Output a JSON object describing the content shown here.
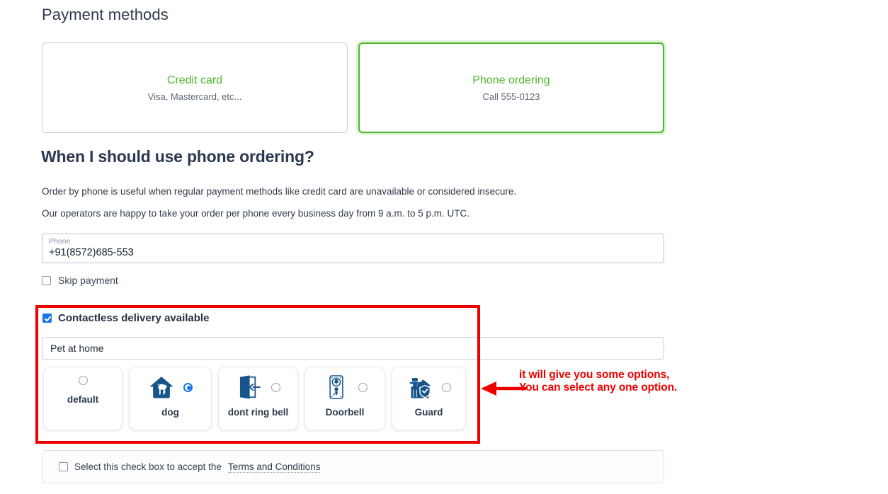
{
  "page_title": "Payment methods",
  "accent_green": "#4cb82a",
  "accent_blue": "#1a73e8",
  "annotation_red": "#ee0000",
  "payment_methods": [
    {
      "title": "Credit card",
      "subtitle": "Visa, Mastercard, etc...",
      "selected": false
    },
    {
      "title": "Phone ordering",
      "subtitle": "Call 555-0123",
      "selected": true
    }
  ],
  "section": {
    "heading": "When I should use phone ordering?",
    "paragraph_1": "Order by phone is useful when regular payment methods like credit card are unavailable or considered insecure.",
    "paragraph_2": "Our operators are happy to take your order per phone every business day from 9 a.m. to 5 p.m. UTC."
  },
  "phone_field": {
    "label": "Phone",
    "value": "+91(8572)685-553"
  },
  "skip_payment": {
    "label": "Skip payment",
    "checked": false
  },
  "contactless": {
    "label": "Contactless delivery available",
    "checked": true
  },
  "pet_field": {
    "value": "Pet at home"
  },
  "delivery_options": [
    {
      "label": "default",
      "icon": "none",
      "selected": false
    },
    {
      "label": "dog",
      "icon": "dog-house-icon",
      "selected": true
    },
    {
      "label": "dont ring bell",
      "icon": "door-enter-icon",
      "selected": false
    },
    {
      "label": "Doorbell",
      "icon": "doorbell-icon",
      "selected": false
    },
    {
      "label": "Guard",
      "icon": "guard-shield-icon",
      "selected": false
    }
  ],
  "annotation": {
    "line_1": "it will give you some options,",
    "line_2": "You can select any one option.",
    "arrow": "left-arrow-icon"
  },
  "terms": {
    "text": "Select this check box to accept the",
    "link": "Terms and Conditions",
    "checked": false
  }
}
